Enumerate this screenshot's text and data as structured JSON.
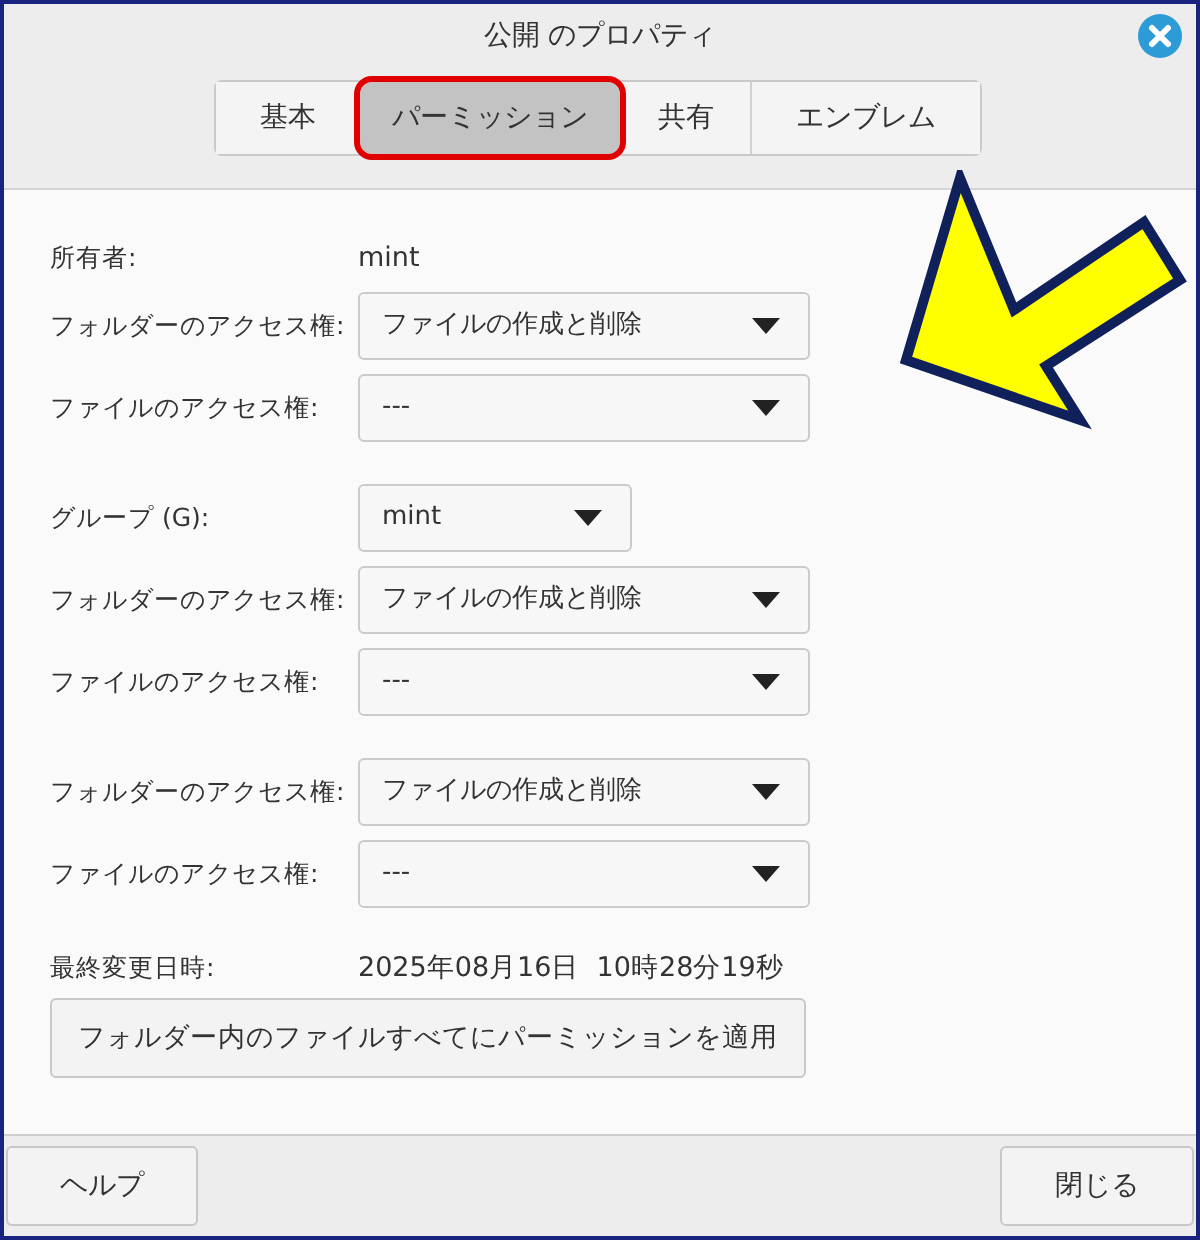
{
  "window": {
    "title": "公開 のプロパティ"
  },
  "tabs": [
    {
      "label": "基本",
      "selected": false,
      "highlighted": false
    },
    {
      "label": "パーミッション",
      "selected": true,
      "highlighted": true
    },
    {
      "label": "共有",
      "selected": false,
      "highlighted": false
    },
    {
      "label": "エンブレム",
      "selected": false,
      "highlighted": false
    }
  ],
  "sections": [
    {
      "rows": [
        {
          "kind": "info",
          "label": "所有者:",
          "value": "mint"
        },
        {
          "kind": "select",
          "label": "フォルダーのアクセス権:",
          "value": "ファイルの作成と削除"
        },
        {
          "kind": "select",
          "label": "ファイルのアクセス権:",
          "value": "---"
        }
      ]
    },
    {
      "rows": [
        {
          "kind": "select-short",
          "label": "グループ (G):",
          "value": "mint"
        },
        {
          "kind": "select",
          "label": "フォルダーのアクセス権:",
          "value": "ファイルの作成と削除"
        },
        {
          "kind": "select",
          "label": "ファイルのアクセス権:",
          "value": "---"
        }
      ]
    },
    {
      "rows": [
        {
          "kind": "select",
          "label": "フォルダーのアクセス権:",
          "value": "ファイルの作成と削除"
        },
        {
          "kind": "select",
          "label": "ファイルのアクセス権:",
          "value": "---"
        }
      ]
    },
    {
      "rows": [
        {
          "kind": "info",
          "label": "最終変更日時:",
          "value": "2025年08月16日  10時28分19秒"
        }
      ]
    }
  ],
  "apply_button": "フォルダー内のファイルすべてにパーミッションを適用",
  "buttons": {
    "help": "ヘルプ",
    "close": "閉じる"
  },
  "callouts": [
    {
      "kind": "arrow"
    }
  ]
}
